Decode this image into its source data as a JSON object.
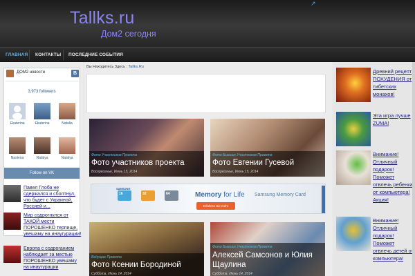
{
  "header": {
    "site_title": "Tallks.ru",
    "site_tagline": "Дом2 сегодня"
  },
  "nav": {
    "items": [
      {
        "label": "Главная",
        "active": true
      },
      {
        "label": "Контакты",
        "active": false
      },
      {
        "label": "Последние события",
        "active": false
      }
    ]
  },
  "vk_widget": {
    "title": "ДОМ2 новости",
    "logo": "B",
    "followers": "3,973 followers",
    "members": [
      {
        "name": "Ekaterina"
      },
      {
        "name": "Ekaterina"
      },
      {
        "name": "Natalia"
      },
      {
        "name": "Nastena"
      },
      {
        "name": "Natalya"
      },
      {
        "name": "Natalya"
      }
    ],
    "follow_button": "Follow on VK"
  },
  "left_news": [
    {
      "text": "Павел Глоба не сдержался и сболтнул, что будет с Украиной, Россией и..."
    },
    {
      "text": "Мир содрогнулся от ТАКОЙ мести ПОРОШЕНКО терпище, увешаму на инаугурации!"
    },
    {
      "text": "Европа с содроганием наблюдает за местью ПОРОШЕНКО увешаму на инаугурации"
    }
  ],
  "main": {
    "breadcrumb_prefix": "Вы Находитесь Здесь :",
    "breadcrumb_link": "Tallks.Ru",
    "posts": [
      {
        "category": "Фото Участников Проекта",
        "title": "Фото участников проекта",
        "date": "Воскресенье, Июнь 15, 2014"
      },
      {
        "category": "Фото Бывших Участников Проекта",
        "title": "Фото Евгении Гусевой",
        "date": "Воскресенье, Июнь 15, 2014"
      },
      {
        "category": "Ведущие Проекта",
        "title": "Фото Ксении Бородиной",
        "date": "Суббота, Июнь 14, 2014"
      },
      {
        "category": "Фото Бывших Участников Проекта",
        "title": "Алексей Самсонов и Юлия Щаулина",
        "date": "Суббота, Июнь 14, 2014"
      }
    ],
    "banner": {
      "brand": "SAMSUNG",
      "cards": [
        "16",
        "32",
        "64"
      ],
      "slogan_a": "Memory",
      "slogan_b": " for Life",
      "product": "Samsung Memory Card",
      "cta": "Erfahren Sie mehr"
    }
  },
  "right_promos": [
    {
      "text": "Древний рецепт ПОХУДЕНИЯ от тибетских монахов!"
    },
    {
      "text": "Эта игра лучше ZUMA!"
    },
    {
      "text": "Внимание! Отличный подарок! Поможет отвлечь ребенка от компьютера! Акция!"
    },
    {
      "text": "Внимание! Отличный подарок! Поможет отвлечь детей от компьютера!"
    }
  ],
  "colors": {
    "title": "#8c84f0",
    "nav_active": "#5fb3ea",
    "link": "#1f1f80",
    "category": "#52c1e8",
    "vk_blue": "#4c75a3"
  }
}
